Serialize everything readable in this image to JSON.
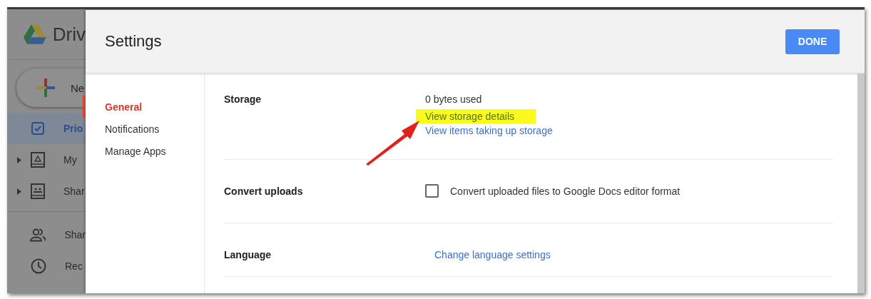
{
  "background_app": {
    "logo_text": "Driv",
    "new_button": "Ne",
    "nav": [
      {
        "label": "Prio",
        "kind": "priority",
        "selected": true,
        "expandable": false
      },
      {
        "label": "My",
        "kind": "drive",
        "selected": false,
        "expandable": true
      },
      {
        "label": "Shar",
        "kind": "shared-drives",
        "selected": false,
        "expandable": true
      },
      {
        "label": "Shar",
        "kind": "shared",
        "selected": false,
        "expandable": false
      },
      {
        "label": "Rec",
        "kind": "recent",
        "selected": false,
        "expandable": false
      }
    ]
  },
  "dialog": {
    "title": "Settings",
    "done_button": "DONE",
    "menu": [
      {
        "label": "General",
        "selected": true
      },
      {
        "label": "Notifications",
        "selected": false
      },
      {
        "label": "Manage Apps",
        "selected": false
      }
    ],
    "sections": [
      {
        "label": "Storage",
        "kind": "storage",
        "usage": "0 bytes used",
        "links": [
          {
            "text": "View storage details",
            "highlighted": true
          },
          {
            "text": "View items taking up storage",
            "highlighted": false
          }
        ]
      },
      {
        "label": "Convert uploads",
        "kind": "checkbox",
        "option": "Convert uploaded files to Google Docs editor format",
        "checked": false
      },
      {
        "label": "Language",
        "kind": "link",
        "link": "Change language settings"
      }
    ]
  }
}
